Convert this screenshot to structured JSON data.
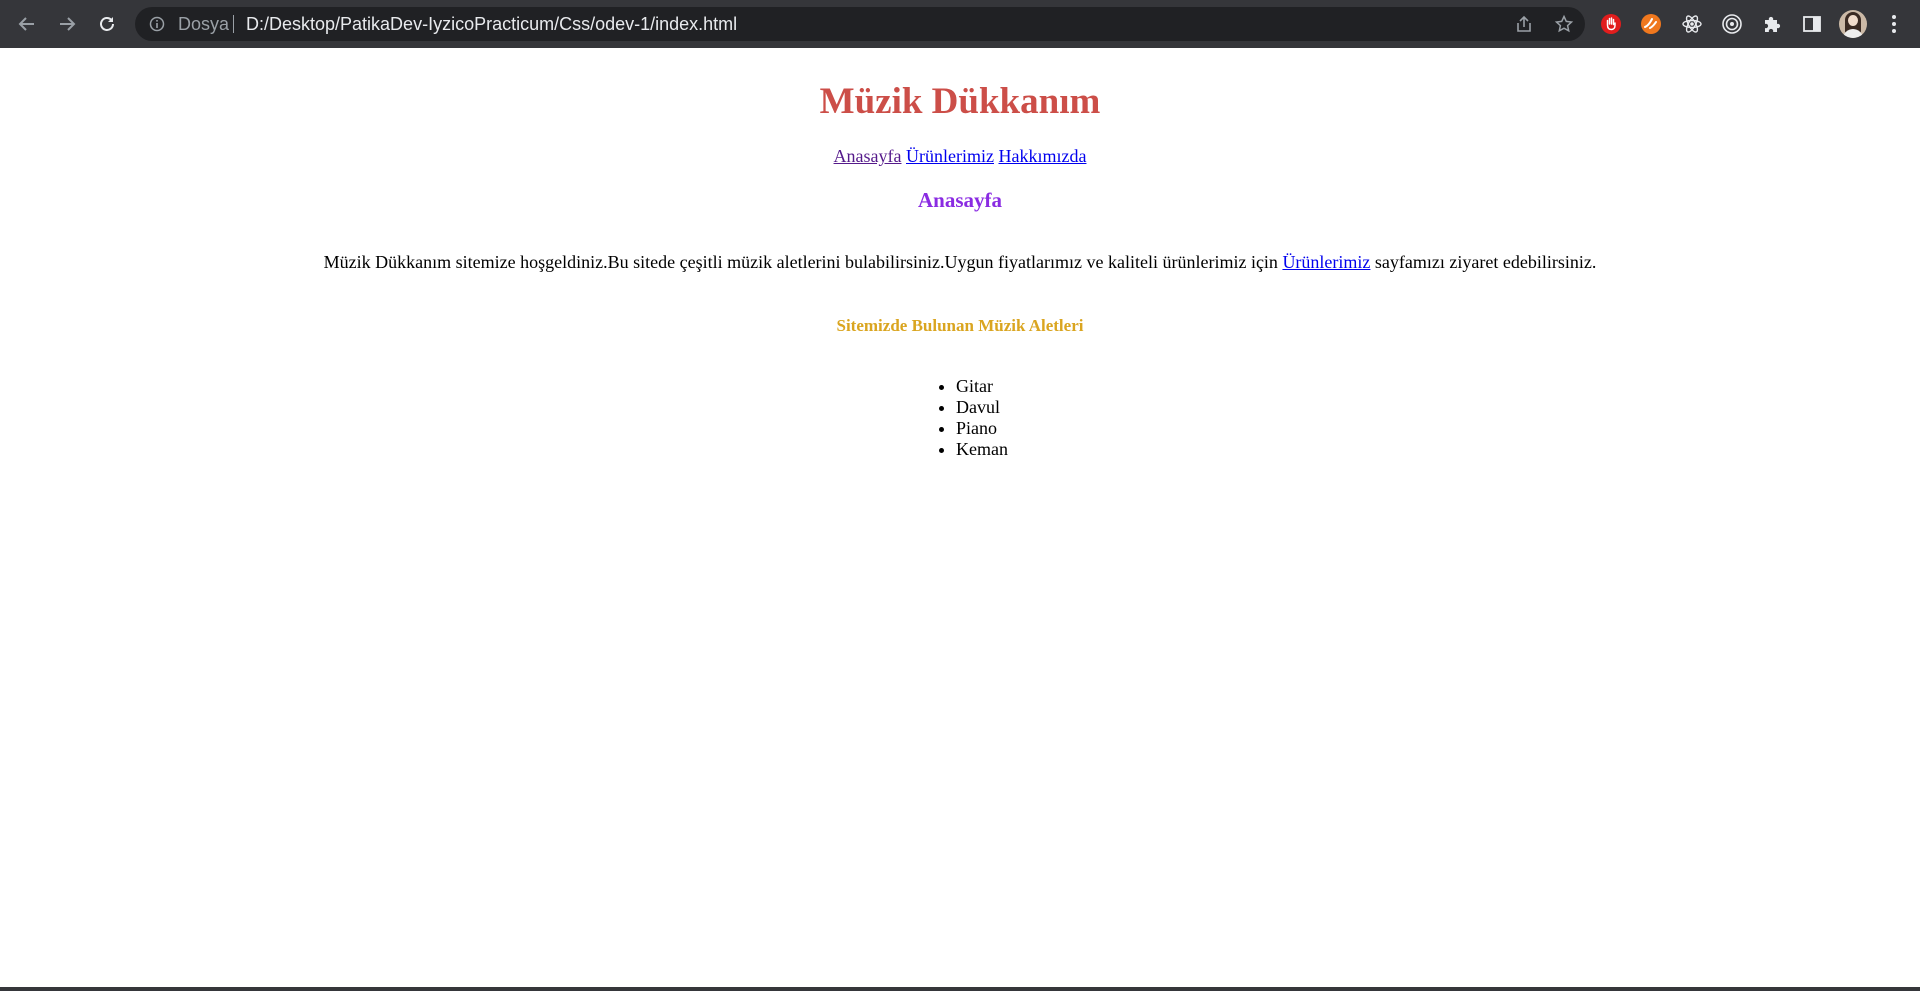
{
  "browser": {
    "site_label": "Dosya",
    "url": "D:/Desktop/PatikaDev-IyzicoPracticum/Css/odev-1/index.html",
    "icons": {
      "back": "arrow-left-icon",
      "forward": "arrow-right-icon",
      "reload": "reload-icon",
      "info": "info-icon",
      "share": "share-icon",
      "bookmark": "star-icon",
      "extensions": [
        "hand-stop-icon",
        "orange-extension-icon",
        "react-atom-icon",
        "target-icon",
        "puzzle-icon",
        "side-panel-icon"
      ],
      "menu": "kebab-menu-icon"
    }
  },
  "page": {
    "title": "Müzik Dükkanım",
    "nav": [
      {
        "label": "Anasayfa",
        "visited": true
      },
      {
        "label": "Ürünlerimiz",
        "visited": false
      },
      {
        "label": "Hakkımızda",
        "visited": false
      }
    ],
    "section_title": "Anasayfa",
    "intro_before": "Müzik Dükkanım sitemize hoşgeldiniz.Bu sitede çeşitli müzik aletlerini bulabilirsiniz.Uygun fiyatlarımız ve kaliteli ürünlerimiz için ",
    "intro_link": "Ürünlerimiz",
    "intro_after": " sayfamızı ziyaret edebilirsiniz.",
    "list_title": "Sitemizde Bulunan Müzik Aletleri",
    "instruments": [
      "Gitar",
      "Davul",
      "Piano",
      "Keman"
    ]
  },
  "colors": {
    "title": "#cc4e48",
    "section_title": "#8a2be2",
    "list_title": "#daa520",
    "link": "#0000ee",
    "visited_link": "#551a8b",
    "chrome_bar": "#35363a"
  }
}
